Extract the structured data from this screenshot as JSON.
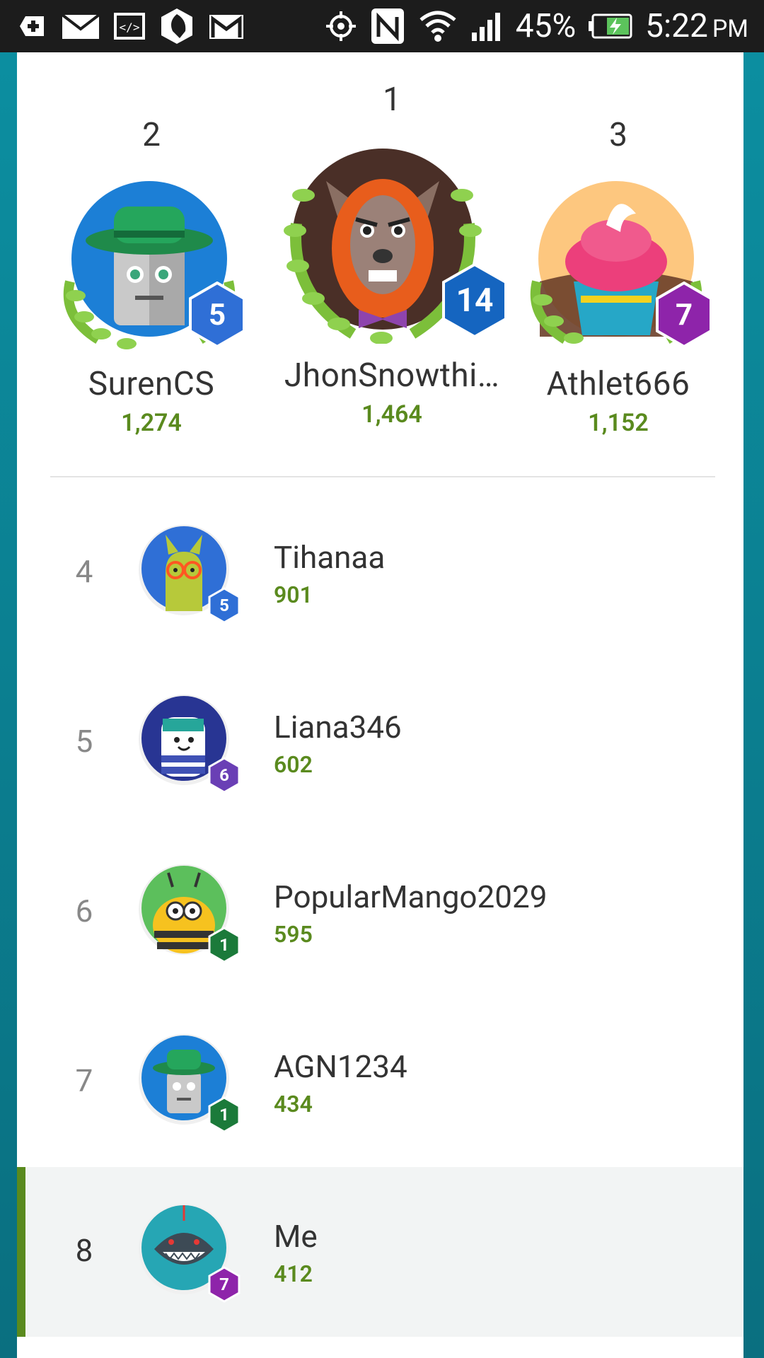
{
  "status_bar": {
    "battery": "45%",
    "time": "5:22",
    "ampm": "PM"
  },
  "podium": [
    {
      "rank": "2",
      "name": "SurenCS",
      "score": "1,274",
      "level": "5"
    },
    {
      "rank": "1",
      "name": "JhonSnowthi…",
      "score": "1,464",
      "level": "14"
    },
    {
      "rank": "3",
      "name": "Athlet666",
      "score": "1,152",
      "level": "7"
    }
  ],
  "leaderboard": [
    {
      "rank": "4",
      "name": "Tihanaa",
      "score": "901",
      "level": "5"
    },
    {
      "rank": "5",
      "name": "Liana346",
      "score": "602",
      "level": "6"
    },
    {
      "rank": "6",
      "name": "PopularMango2029",
      "score": "595",
      "level": "1"
    },
    {
      "rank": "7",
      "name": "AGN1234",
      "score": "434",
      "level": "1"
    },
    {
      "rank": "8",
      "name": "Me",
      "score": "412",
      "level": "7"
    }
  ],
  "icons": {
    "status_left": [
      "add-box-icon",
      "mail-icon",
      "code-icon",
      "settings-face-icon",
      "gmail-icon"
    ],
    "status_right": [
      "gps-icon",
      "nfc-icon",
      "wifi-icon",
      "signal-icon",
      "battery-charging-icon"
    ]
  },
  "colors": {
    "accent_green": "#5a8a1e",
    "level_blue": "#2f6fd6",
    "level_dark_blue": "#1565c0",
    "level_purple": "#8e24aa",
    "level_green": "#1b7a3a",
    "teal_frame": "#0e7f8f"
  }
}
